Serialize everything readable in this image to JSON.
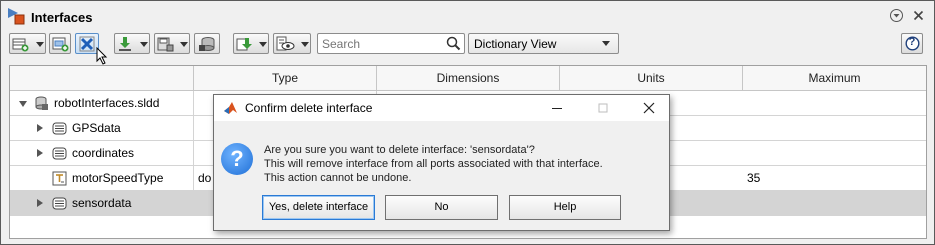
{
  "window": {
    "title": "Interfaces"
  },
  "toolbar": {
    "search_placeholder": "Search",
    "view_selected": "Dictionary View",
    "help_label": "?"
  },
  "table": {
    "columns": [
      "",
      "Type",
      "Dimensions",
      "Units",
      "Maximum"
    ],
    "rows": [
      {
        "name": "robotInterfaces.sldd",
        "type": "",
        "maximum": ""
      },
      {
        "name": "GPSdata",
        "type": "",
        "maximum": ""
      },
      {
        "name": "coordinates",
        "type": "",
        "maximum": ""
      },
      {
        "name": "motorSpeedType",
        "type": "do",
        "maximum": "35"
      },
      {
        "name": "sensordata",
        "type": "",
        "maximum": ""
      }
    ]
  },
  "dialog": {
    "title": "Confirm delete interface",
    "message_lines": [
      "Are you sure you want to delete interface: 'sensordata'?",
      "This will remove interface from all ports associated with that interface.",
      "This action cannot be undone."
    ],
    "icon_glyph": "?",
    "buttons": {
      "yes": "Yes, delete interface",
      "no": "No",
      "help": "Help"
    }
  },
  "colors": {
    "selected_row": "#d4d4d4",
    "dialog_icon": "#1f6fd6",
    "primary_button_border": "#2a7ad5"
  }
}
